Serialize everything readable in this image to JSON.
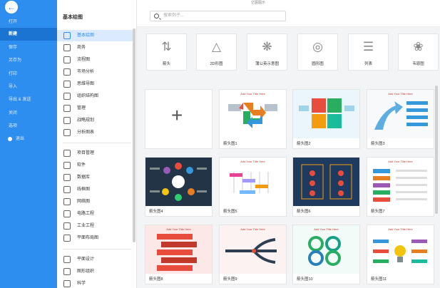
{
  "app": {
    "title": "亿图图示"
  },
  "left_menu": {
    "items": [
      {
        "label": "打开"
      },
      {
        "label": "新建"
      },
      {
        "label": "保存"
      },
      {
        "label": "另存为"
      },
      {
        "label": "打印"
      },
      {
        "label": "导入"
      },
      {
        "label": "导出 & 发送"
      },
      {
        "label": "关闭"
      },
      {
        "label": "选项"
      },
      {
        "label": "退出"
      }
    ]
  },
  "categories": {
    "title": "基本绘图",
    "group1": [
      {
        "label": "基本绘图"
      },
      {
        "label": "商务"
      },
      {
        "label": "流程图"
      },
      {
        "label": "市场分析"
      },
      {
        "label": "思维导图"
      },
      {
        "label": "组织结构图"
      },
      {
        "label": "管理"
      },
      {
        "label": "战略规划"
      },
      {
        "label": "分析图表"
      }
    ],
    "group2": [
      {
        "label": "项目管理"
      },
      {
        "label": "软件"
      },
      {
        "label": "数据库"
      },
      {
        "label": "线框图"
      },
      {
        "label": "网络图"
      },
      {
        "label": "电路工程"
      },
      {
        "label": "工业工程"
      },
      {
        "label": "平面布局图"
      }
    ],
    "group3": [
      {
        "label": "平面设计"
      },
      {
        "label": "图形组织"
      },
      {
        "label": "科学"
      }
    ]
  },
  "search": {
    "placeholder": "搜索例子..."
  },
  "subtypes": [
    {
      "label": "箭头",
      "icon": "arrows-icon",
      "glyph": "⇅"
    },
    {
      "label": "2D形图",
      "icon": "shapes-2d-icon",
      "glyph": "△"
    },
    {
      "label": "蒲公英示意图",
      "icon": "dandelion-icon",
      "glyph": "❋"
    },
    {
      "label": "圆形图",
      "icon": "circle-diagram-icon",
      "glyph": "◎"
    },
    {
      "label": "列表",
      "icon": "list-icon",
      "glyph": "☰"
    },
    {
      "label": "韦恩图",
      "icon": "venn-icon",
      "glyph": "❀"
    }
  ],
  "templates": [
    {
      "label": ""
    },
    {
      "label": "箭头图1",
      "mini_title": "Add Your Title Here"
    },
    {
      "label": "箭头图2",
      "mini_title": ""
    },
    {
      "label": "箭头图3",
      "mini_title": "Add Your Title Here"
    },
    {
      "label": "箭头图4",
      "mini_title": ""
    },
    {
      "label": "箭头图5",
      "mini_title": "Add Your Title Here"
    },
    {
      "label": "箭头图6",
      "mini_title": ""
    },
    {
      "label": "箭头图7",
      "mini_title": "Add Your Title Here"
    },
    {
      "label": "箭头图8",
      "mini_title": "Add Your Title Here"
    },
    {
      "label": "箭头图9",
      "mini_title": "Add Your Title Here"
    },
    {
      "label": "箭头图10",
      "mini_title": "Add Your Title Here"
    },
    {
      "label": "箭头图11",
      "mini_title": "Add Your Title Here"
    }
  ],
  "colors": {
    "accent": "#2e8ef0",
    "sidebar": "#2e8ef0",
    "active_category": "#dbeaff"
  }
}
